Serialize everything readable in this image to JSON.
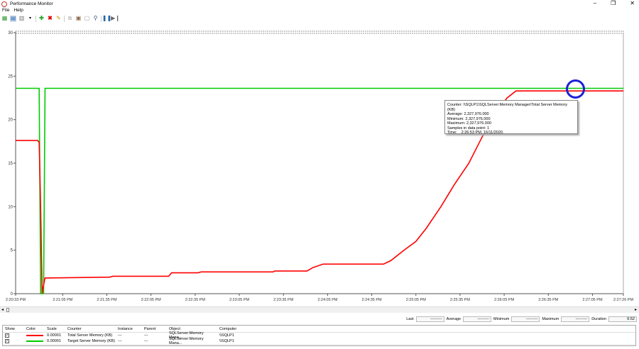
{
  "window": {
    "title": "Performance Monitor"
  },
  "menu": [
    "File",
    "Help"
  ],
  "toolbar_icons": [
    "view-graph-icon",
    "view-histogram-icon",
    "view-report-icon",
    "dropdown-icon",
    "add-counter-icon",
    "delete-counter-icon",
    "highlight-icon",
    "copy-icon",
    "paste-icon",
    "properties-icon",
    "zoom-icon",
    "freeze-icon",
    "update-icon"
  ],
  "chart_data": {
    "type": "line",
    "xlabel": "",
    "ylabel": "",
    "ylim": [
      0,
      30
    ],
    "yticks": [
      "0",
      "5",
      "10",
      "15",
      "20",
      "25",
      "30"
    ],
    "xlim_seconds": [
      0,
      413
    ],
    "xtick_labels": [
      "2:20:33 PM",
      "2:21:05 PM",
      "2:21:35 PM",
      "2:22:05 PM",
      "2:22:35 PM",
      "2:23:05 PM",
      "2:23:35 PM",
      "2:24:05 PM",
      "2:24:35 PM",
      "2:25:05 PM",
      "2:25:35 PM",
      "2:26:05 PM",
      "2:26:35 PM",
      "2:27:05 PM",
      "2:27:26 PM"
    ],
    "xtick_seconds": [
      0,
      32,
      62,
      92,
      122,
      152,
      182,
      212,
      242,
      272,
      302,
      332,
      362,
      392,
      413
    ],
    "series": [
      {
        "name": "Total Server Memory (KB)",
        "color": "#ff0000",
        "x": [
          0,
          15,
          16,
          17,
          18,
          19,
          20,
          64,
          66,
          104,
          106,
          124,
          126,
          175,
          176,
          198,
          202,
          209,
          250,
          255,
          264,
          272,
          279,
          289,
          298,
          308,
          317,
          327,
          334,
          340,
          413
        ],
        "y": [
          17.6,
          17.6,
          17.4,
          10,
          0,
          1.0,
          1.8,
          1.9,
          2.0,
          2.0,
          2.4,
          2.4,
          2.5,
          2.5,
          2.6,
          2.6,
          3.0,
          3.4,
          3.4,
          3.8,
          5.0,
          6.0,
          7.5,
          10,
          12.5,
          15,
          18,
          21,
          22.5,
          23.3,
          23.3
        ]
      },
      {
        "name": "Target Server Memory (KB)",
        "color": "#00cc00",
        "x": [
          0,
          16,
          17,
          19,
          20,
          413
        ],
        "y": [
          23.6,
          23.6,
          0,
          0,
          23.6,
          23.6
        ]
      }
    ]
  },
  "tooltip": {
    "lines": [
      "Counter: \\\\SQLP1\\SQLServer:Memory Manager\\Total Server Memory (KB)",
      "Average: 2,327,976.000",
      "Minimum: 2,327,976.000",
      "Maximum: 2,327,976.000",
      "Samples in data point:  1",
      "Time:    2:26:53 PM, 16/11/2020."
    ]
  },
  "stats": {
    "last_label": "Last",
    "last": "---------",
    "average_label": "Average",
    "average": "---------",
    "minimum_label": "Minimum",
    "minimum": "---------",
    "maximum_label": "Maximum",
    "maximum": "---------",
    "duration_label": "Duration",
    "duration": "6:52"
  },
  "legend": {
    "headers": [
      "Show",
      "Color",
      "Scale",
      "Counter",
      "Instance",
      "Parent",
      "Object",
      "Computer"
    ],
    "rows": [
      {
        "scale": "0.00001",
        "counter": "Total Server Memory (KB)",
        "instance": "---",
        "parent": "---",
        "object": "SQLServer:Memory Mana...",
        "computer": "\\\\SQLP1",
        "color": "#ff0000"
      },
      {
        "scale": "0.00001",
        "counter": "Target Server Memory (KB)",
        "instance": "---",
        "parent": "---",
        "object": "SQLServer:Memory Mana...",
        "computer": "\\\\SQLP1",
        "color": "#00cc00"
      }
    ]
  }
}
